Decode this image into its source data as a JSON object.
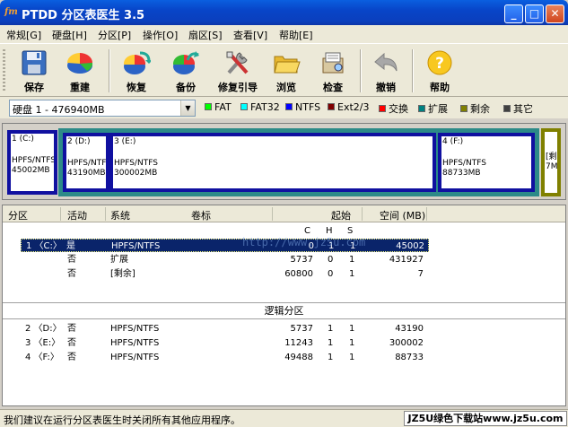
{
  "window": {
    "title": "PTDD 分区表医生 3.5",
    "icon_label": "fm"
  },
  "menu": [
    {
      "label": "常规[G]"
    },
    {
      "label": "硬盘[H]"
    },
    {
      "label": "分区[P]"
    },
    {
      "label": "操作[O]"
    },
    {
      "label": "扇区[S]"
    },
    {
      "label": "查看[V]"
    },
    {
      "label": "帮助[E]"
    }
  ],
  "toolbar": [
    {
      "label": "保存",
      "icon": "floppy-disk-icon"
    },
    {
      "label": "重建",
      "icon": "pie-disk-icon"
    },
    {
      "label": "恢复",
      "icon": "restore-pie-icon"
    },
    {
      "label": "备份",
      "icon": "backup-pie-icon"
    },
    {
      "label": "修复引导",
      "icon": "tools-icon"
    },
    {
      "label": "浏览",
      "icon": "folder-icon"
    },
    {
      "label": "检查",
      "icon": "inspect-icon"
    },
    {
      "label": "撤销",
      "icon": "undo-arrow-icon"
    },
    {
      "label": "帮助",
      "icon": "help-icon"
    }
  ],
  "disk_select": {
    "value": "硬盘 1 - 476940MB"
  },
  "legend": [
    {
      "label": "FAT",
      "color": "#00ff00"
    },
    {
      "label": "FAT32",
      "color": "#00ffff"
    },
    {
      "label": "NTFS",
      "color": "#0000ff"
    },
    {
      "label": "Ext2/3",
      "color": "#800000"
    },
    {
      "label": "交换",
      "color": "#ff0000"
    },
    {
      "label": "扩展",
      "color": "#008080"
    },
    {
      "label": "剩余",
      "color": "#808000"
    },
    {
      "label": "其它",
      "color": "#404040"
    }
  ],
  "disk_map": [
    {
      "name": "1 (C:)",
      "fs": "HPFS/NTFS",
      "size": "45002MB"
    },
    {
      "name": "2 (D:)",
      "fs": "HPFS/NTFS",
      "size": "43190MB"
    },
    {
      "name": "3 (E:)",
      "fs": "HPFS/NTFS",
      "size": "300002MB"
    },
    {
      "name": "4 (F:)",
      "fs": "HPFS/NTFS",
      "size": "88733MB"
    },
    {
      "name": "[剩",
      "fs": "",
      "size": "7M"
    }
  ],
  "table": {
    "headers": [
      "分区",
      "活动",
      "系统",
      "卷标",
      "起始",
      "空间 (MB)"
    ],
    "subheaders": [
      "C",
      "H",
      "S"
    ],
    "primary_rows": [
      {
        "part": "1 〈C:〉",
        "active": "是",
        "system": "HPFS/NTFS",
        "c": "0",
        "h": "1",
        "s": "1",
        "size": "45002",
        "selected": true
      },
      {
        "part": "",
        "active": "否",
        "system": "扩展",
        "c": "5737",
        "h": "0",
        "s": "1",
        "size": "431927",
        "selected": false
      },
      {
        "part": "",
        "active": "否",
        "system": "[剩余]",
        "c": "60800",
        "h": "0",
        "s": "1",
        "size": "7",
        "selected": false
      }
    ],
    "logical_title": "逻辑分区",
    "logical_rows": [
      {
        "part": "2 〈D:〉",
        "active": "否",
        "system": "HPFS/NTFS",
        "c": "5737",
        "h": "1",
        "s": "1",
        "size": "43190"
      },
      {
        "part": "3 〈E:〉",
        "active": "否",
        "system": "HPFS/NTFS",
        "c": "11243",
        "h": "1",
        "s": "1",
        "size": "300002"
      },
      {
        "part": "4 〈F:〉",
        "active": "否",
        "system": "HPFS/NTFS",
        "c": "49488",
        "h": "1",
        "s": "1",
        "size": "88733"
      }
    ]
  },
  "watermark": "http://www.jz5u.com",
  "status": {
    "text": "我们建议在运行分区表医生时关闭所有其他应用程序。",
    "badge": "JZ5U绿色下载站www.jz5u.com"
  }
}
